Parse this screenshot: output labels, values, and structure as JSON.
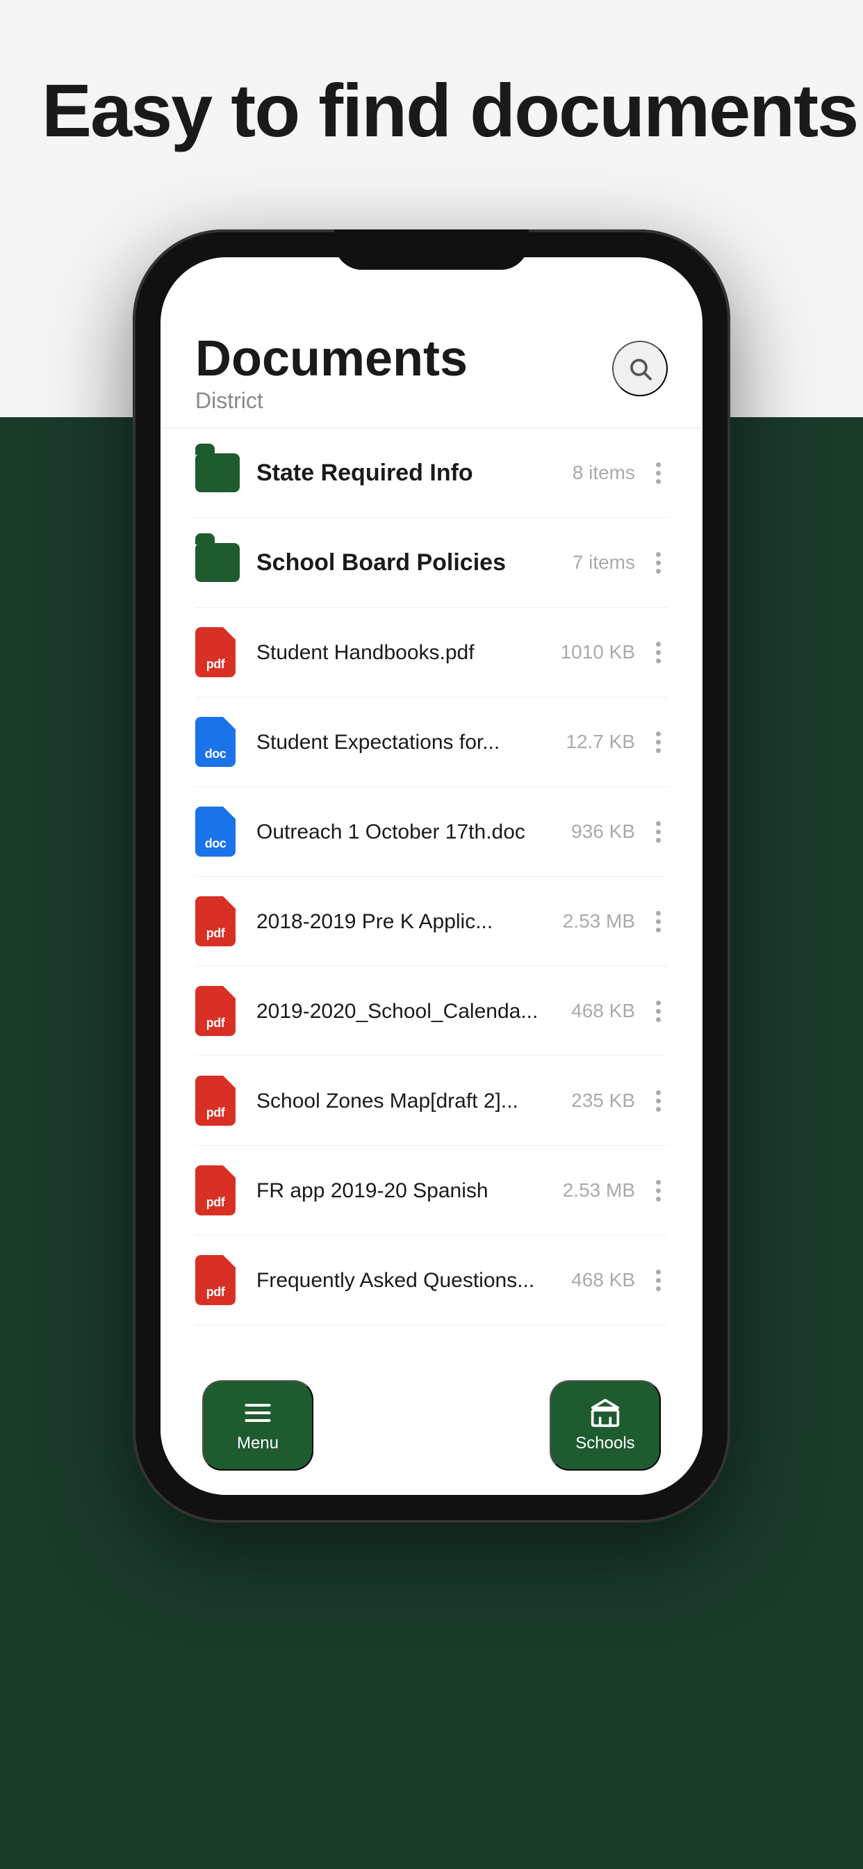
{
  "page": {
    "hero_title": "Easy to find documents",
    "bg_top_color": "#f5f5f5",
    "bg_bottom_color": "#1a3a2a"
  },
  "app": {
    "header": {
      "title": "Documents",
      "subtitle": "District"
    },
    "search_icon": "search",
    "folders": [
      {
        "name": "State Required Info",
        "meta": "8 items"
      },
      {
        "name": "School Board Policies",
        "meta": "7 items"
      }
    ],
    "files": [
      {
        "name": "Student Handbooks.pdf",
        "type": "pdf",
        "meta": "1010 KB",
        "icon_label": "pdf"
      },
      {
        "name": "Student Expectations for...",
        "type": "doc",
        "meta": "12.7 KB",
        "icon_label": "doc"
      },
      {
        "name": "Outreach 1 October 17th.doc",
        "type": "doc",
        "meta": "936 KB",
        "icon_label": "doc"
      },
      {
        "name": "2018-2019 Pre K Applic...",
        "type": "pdf",
        "meta": "2.53 MB",
        "icon_label": "pdf"
      },
      {
        "name": "2019-2020_School_Calenda...",
        "type": "pdf",
        "meta": "468 KB",
        "icon_label": "pdf"
      },
      {
        "name": "School Zones Map[draft 2]...",
        "type": "pdf",
        "meta": "235 KB",
        "icon_label": "pdf"
      },
      {
        "name": "FR app 2019-20 Spanish",
        "type": "pdf",
        "meta": "2.53 MB",
        "icon_label": "pdf"
      },
      {
        "name": "Frequently Asked Questions...",
        "type": "pdf",
        "meta": "468 KB",
        "icon_label": "pdf"
      }
    ],
    "nav": {
      "menu_label": "Menu",
      "schools_label": "Schools"
    }
  }
}
